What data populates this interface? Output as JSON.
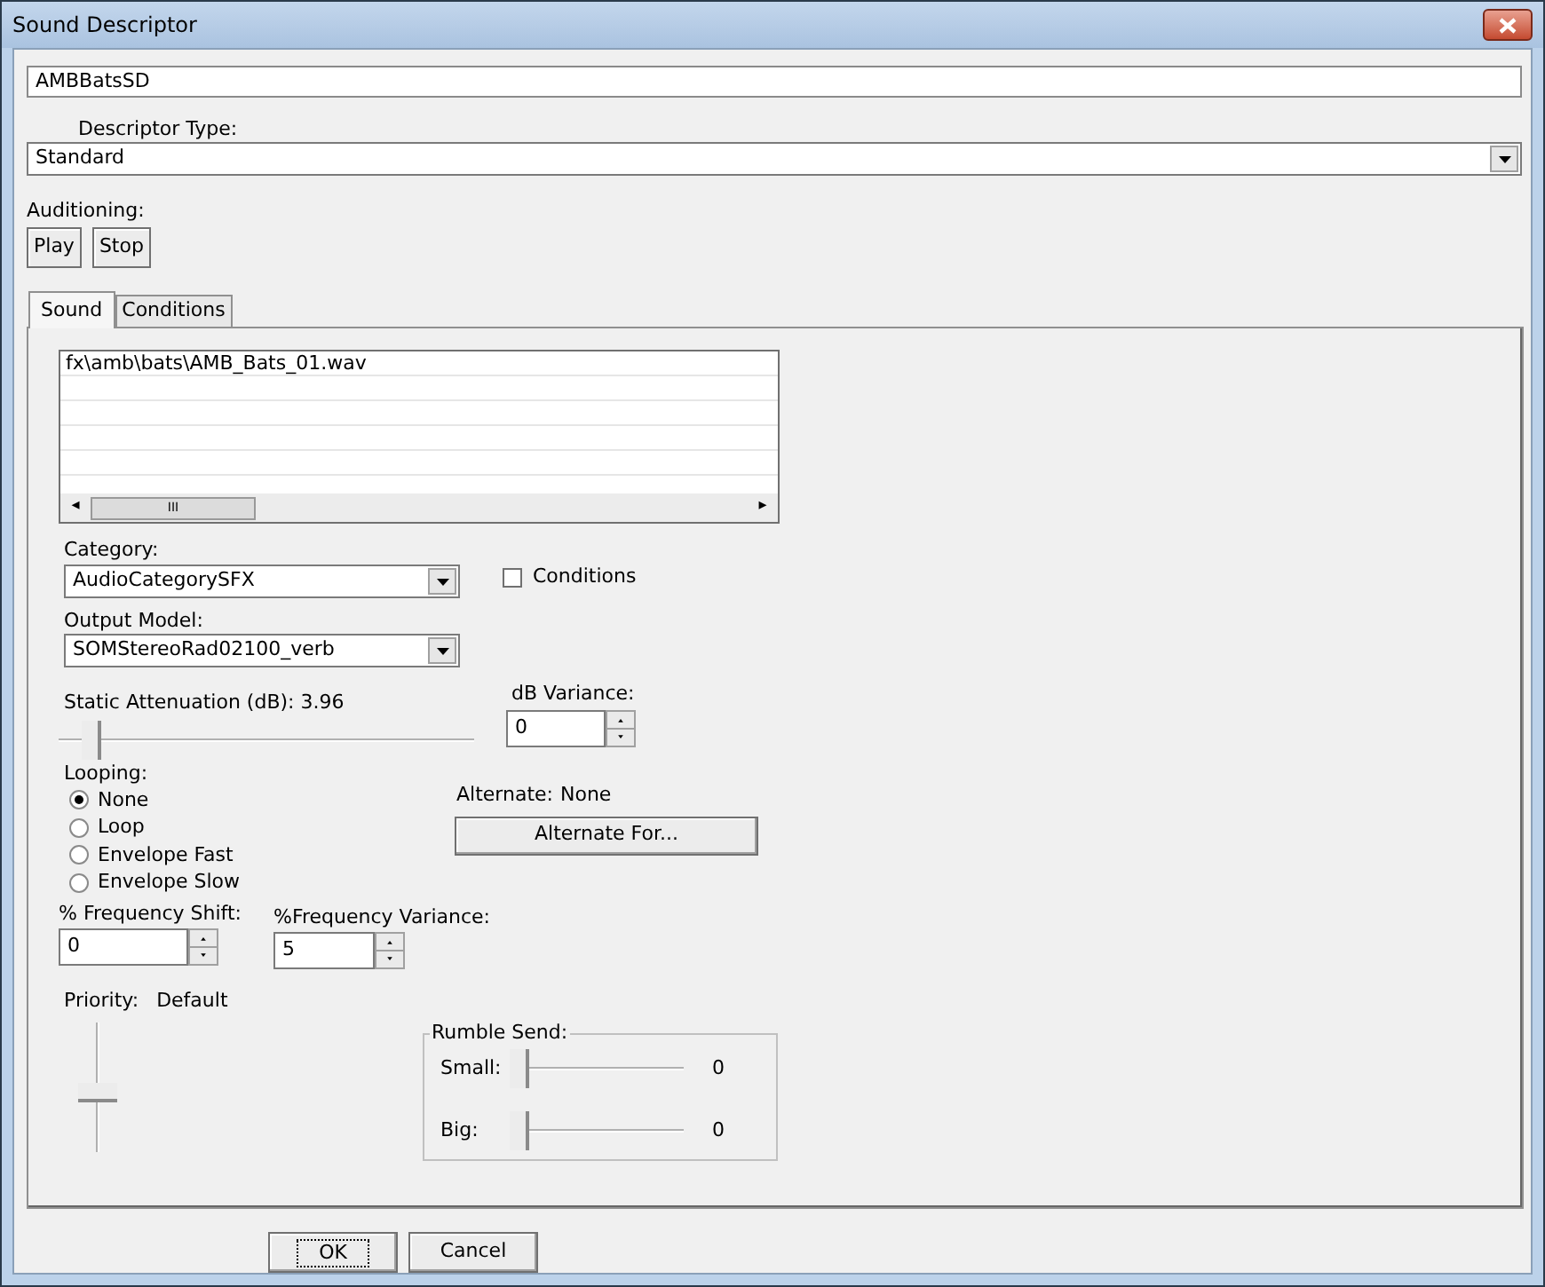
{
  "window": {
    "title": "Sound Descriptor"
  },
  "name_field": {
    "value": "AMBBatsSD"
  },
  "descriptor_type": {
    "label": "Descriptor Type:",
    "value": "Standard"
  },
  "auditioning": {
    "label": "Auditioning:",
    "buttons": [
      "Play",
      "Stop"
    ]
  },
  "tabs": [
    {
      "label": "Sound",
      "selected": true
    },
    {
      "label": "Conditions",
      "selected": false
    }
  ],
  "sound_list": {
    "items": [
      "fx\\amb\\bats\\AMB_Bats_01.wav"
    ],
    "scroll_arrows": [
      "◂",
      "▸"
    ],
    "scroll_grip": "III"
  },
  "category": {
    "label": "Category:",
    "value": "AudioCategorySFX"
  },
  "conditions_checkbox": {
    "label": "Conditions",
    "checked": false
  },
  "output_model": {
    "label": "Output Model:",
    "value": "SOMStereoRad02100_verb"
  },
  "static_attenuation": {
    "label": "Static Attenuation (dB): 3.96",
    "level": 0.06
  },
  "db_variance": {
    "label": "dB Variance:",
    "value": "0"
  },
  "looping": {
    "label": "Looping:",
    "options": [
      {
        "label": "None",
        "selected": true
      },
      {
        "label": "Loop",
        "selected": false
      },
      {
        "label": "Envelope Fast",
        "selected": false
      },
      {
        "label": "Envelope Slow",
        "selected": false
      }
    ]
  },
  "alternate": {
    "label": "Alternate:",
    "value": "None",
    "button": "Alternate For..."
  },
  "frequency_shift": {
    "label": "% Frequency Shift:",
    "value": "0"
  },
  "frequency_variance": {
    "label": "%Frequency Variance:",
    "value": "5"
  },
  "priority": {
    "label": "Priority:",
    "value": "Default",
    "level": 0.45
  },
  "rumble_send": {
    "title": "Rumble Send:",
    "sliders": [
      {
        "label": "Small:",
        "level": 0,
        "reading": "0"
      },
      {
        "label": "Big:",
        "level": 0,
        "reading": "0"
      }
    ]
  },
  "footer_buttons": [
    {
      "label": "OK",
      "focused": true
    },
    {
      "label": "Cancel",
      "focused": false
    }
  ]
}
